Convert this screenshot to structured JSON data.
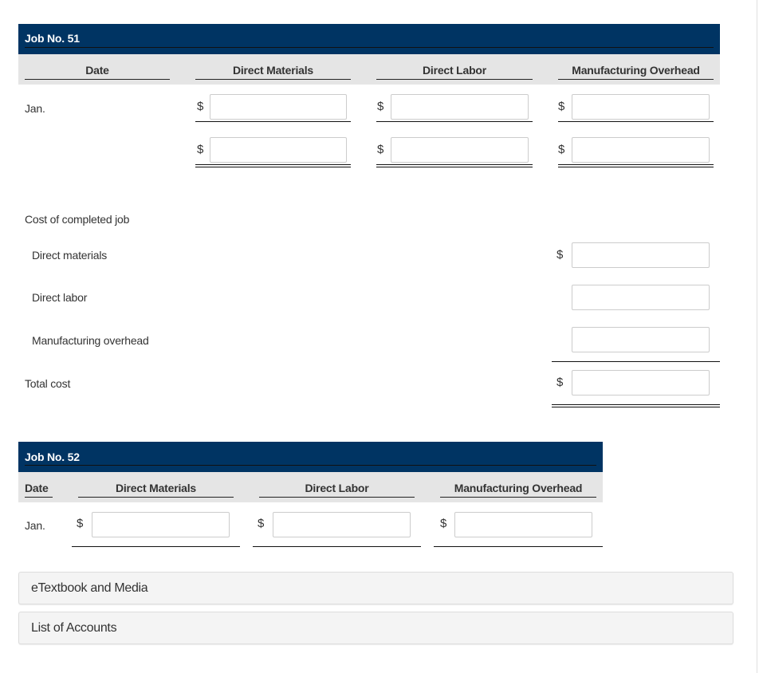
{
  "job51": {
    "title": "Job No. 51",
    "columns": [
      "Date",
      "Direct Materials",
      "Direct Labor",
      "Manufacturing Overhead"
    ],
    "rows": [
      {
        "date": "Jan.",
        "currency": "$",
        "direct_materials": "",
        "direct_labor": "",
        "manufacturing_overhead": ""
      },
      {
        "date": "",
        "currency": "$",
        "direct_materials": "",
        "direct_labor": "",
        "manufacturing_overhead": ""
      }
    ],
    "cost_section": {
      "heading": "Cost of completed job",
      "lines": [
        {
          "label": "Direct materials",
          "currency": "$",
          "value": ""
        },
        {
          "label": "Direct labor",
          "currency": "",
          "value": ""
        },
        {
          "label": "Manufacturing overhead",
          "currency": "",
          "value": ""
        }
      ],
      "total": {
        "label": "Total cost",
        "currency": "$",
        "value": ""
      }
    }
  },
  "job52": {
    "title": "Job No. 52",
    "columns": [
      "Date",
      "Direct Materials",
      "Direct Labor",
      "Manufacturing Overhead"
    ],
    "rows": [
      {
        "date": "Jan.",
        "currency": "$",
        "direct_materials": "",
        "direct_labor": "",
        "manufacturing_overhead": ""
      }
    ]
  },
  "links": {
    "etextbook": "eTextbook and Media",
    "list_of_accounts": "List of Accounts"
  },
  "colors": {
    "header_band": "#003463",
    "column_band": "#e5e5e5",
    "panel_bg": "#f4f4f4"
  }
}
